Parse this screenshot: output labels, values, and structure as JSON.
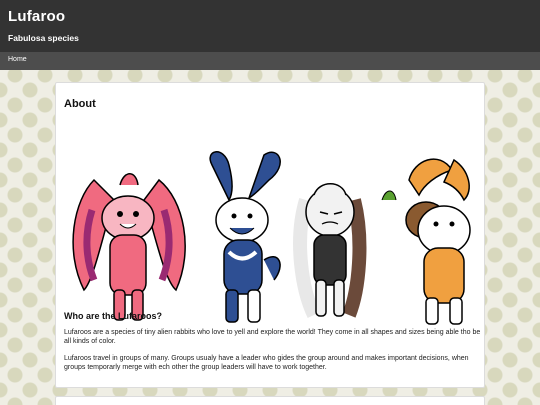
{
  "header": {
    "title": "Lufaroo",
    "subtitle": "Fabulosa species"
  },
  "nav": {
    "items": [
      {
        "label": "Home"
      }
    ]
  },
  "about": {
    "heading": "About",
    "section_heading": "Who are the Lufaroos?",
    "paragraphs": [
      "Lufaroos are a species of tiny alien rabbits who love to yell and explore the world! They come in all shapes and sizes being able tho be all kinds of color.",
      "Lufaroos travel in groups of many. Groups usualy have a leader who gides the group around and makes important decisions, when groups temporarly merge with ech other the group leaders will have to work together."
    ]
  },
  "colors": {
    "header_bg": "#333333",
    "nav_bg": "#4d4d4d",
    "page_bg": "#efeee4",
    "dot_pattern": "#d8d8bd",
    "pink_lufaroo": "#f06a80",
    "magenta_lufaroo": "#9a2a72",
    "blue_lufaroo": "#2e4f93",
    "brown_lufaroo": "#6b4a3a",
    "orange_lufaroo": "#f0a040"
  },
  "artwork": {
    "description_icons": [
      "pink-lufaroo-icon",
      "blue-lufaroo-icon",
      "grey-lufaroo-icon",
      "orange-lufaroo-icon"
    ]
  }
}
